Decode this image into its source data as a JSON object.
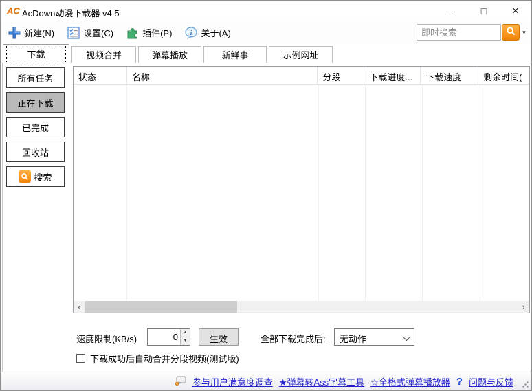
{
  "window": {
    "title": "AcDown动漫下载器 v4.5",
    "logo_text": "AC"
  },
  "icons": {
    "minimize": "–",
    "maximize": "□",
    "close": "×",
    "search_dropdown": "▾",
    "spinner_up": "▲",
    "spinner_down": "▼",
    "scroll_left": "‹",
    "scroll_right": "›",
    "help": "?"
  },
  "toolbar": {
    "buttons": [
      {
        "label": "新建(N)",
        "icon": "new-plus-icon"
      },
      {
        "label": "设置(C)",
        "icon": "settings-checklist-icon"
      },
      {
        "label": "插件(P)",
        "icon": "plugin-puzzle-icon"
      },
      {
        "label": "关于(A)",
        "icon": "about-info-icon"
      }
    ],
    "search": {
      "placeholder": "即时搜索"
    }
  },
  "tabs": [
    {
      "label": "下载",
      "active": true
    },
    {
      "label": "视频合并",
      "active": false
    },
    {
      "label": "弹幕播放",
      "active": false
    },
    {
      "label": "新鲜事",
      "active": false
    },
    {
      "label": "示例网址",
      "active": false
    }
  ],
  "sidebar": {
    "items": [
      {
        "label": "所有任务",
        "active": false
      },
      {
        "label": "正在下载",
        "active": true
      },
      {
        "label": "已完成",
        "active": false
      },
      {
        "label": "回收站",
        "active": false
      },
      {
        "label": "搜索",
        "active": false,
        "icon": "search-icon"
      }
    ]
  },
  "table": {
    "columns": [
      "状态",
      "名称",
      "分段",
      "下载进度...",
      "下载速度",
      "剩余时间("
    ],
    "rows": []
  },
  "controls": {
    "speed_limit_label": "速度限制(KB/s)",
    "speed_limit_value": "0",
    "apply_button": "生效",
    "after_complete_label": "全部下载完成后:",
    "after_complete_value": "无动作",
    "auto_merge_checkbox": {
      "label": "下载成功后自动合并分段视频(测试版)",
      "checked": false
    }
  },
  "statusbar": {
    "survey_link": "参与用户满意度调查",
    "ass_tool_link": "★弹幕转Ass字幕工具",
    "player_link": "☆全格式弹幕播放器",
    "feedback_link": "问题与反馈"
  },
  "colors": {
    "accent_orange": "#F7941D",
    "link_blue": "#2222CC",
    "active_button_gray": "#B9B9B9",
    "plugin_green": "#3FAE6E"
  }
}
